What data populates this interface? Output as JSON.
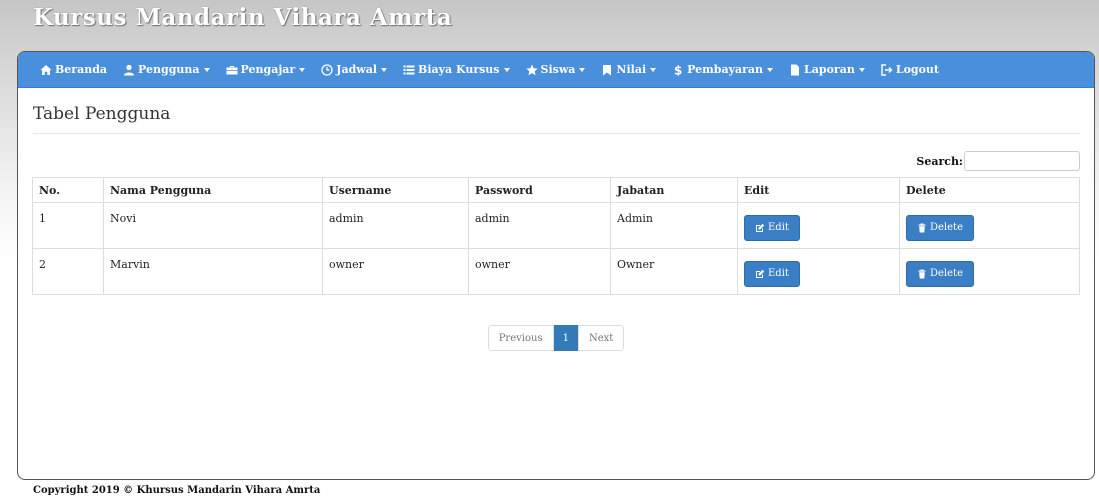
{
  "site": {
    "title": "Kursus Mandarin Vihara Amrta"
  },
  "navbar": {
    "items": [
      {
        "label": "Beranda",
        "icon": "home-icon",
        "dropdown": false
      },
      {
        "label": "Pengguna",
        "icon": "user-icon",
        "dropdown": true
      },
      {
        "label": "Pengajar",
        "icon": "briefcase-icon",
        "dropdown": true
      },
      {
        "label": "Jadwal",
        "icon": "clock-icon",
        "dropdown": true
      },
      {
        "label": "Biaya Kursus",
        "icon": "list-icon",
        "dropdown": true
      },
      {
        "label": "Siswa",
        "icon": "star-icon",
        "dropdown": true
      },
      {
        "label": "Nilai",
        "icon": "bookmark-icon",
        "dropdown": true
      },
      {
        "label": "Pembayaran",
        "icon": "dollar-icon",
        "dropdown": true
      },
      {
        "label": "Laporan",
        "icon": "file-icon",
        "dropdown": true
      },
      {
        "label": "Logout",
        "icon": "logout-icon",
        "dropdown": false
      }
    ],
    "color": "#4a8fdb"
  },
  "page": {
    "title": "Tabel Pengguna"
  },
  "search": {
    "label": "Search:",
    "value": ""
  },
  "table": {
    "headers": [
      "No.",
      "Nama Pengguna",
      "Username",
      "Password",
      "Jabatan",
      "Edit",
      "Delete"
    ],
    "rows": [
      {
        "no": "1",
        "nama": "Novi",
        "username": "admin",
        "password": "admin",
        "jabatan": "Admin"
      },
      {
        "no": "2",
        "nama": "Marvin",
        "username": "owner",
        "password": "owner",
        "jabatan": "Owner"
      }
    ],
    "edit_label": "Edit",
    "delete_label": "Delete"
  },
  "pagination": {
    "previous": "Previous",
    "current": "1",
    "next": "Next"
  },
  "footer": {
    "text": "Copyright 2019 © Khursus Mandarin Vihara Amrta"
  }
}
